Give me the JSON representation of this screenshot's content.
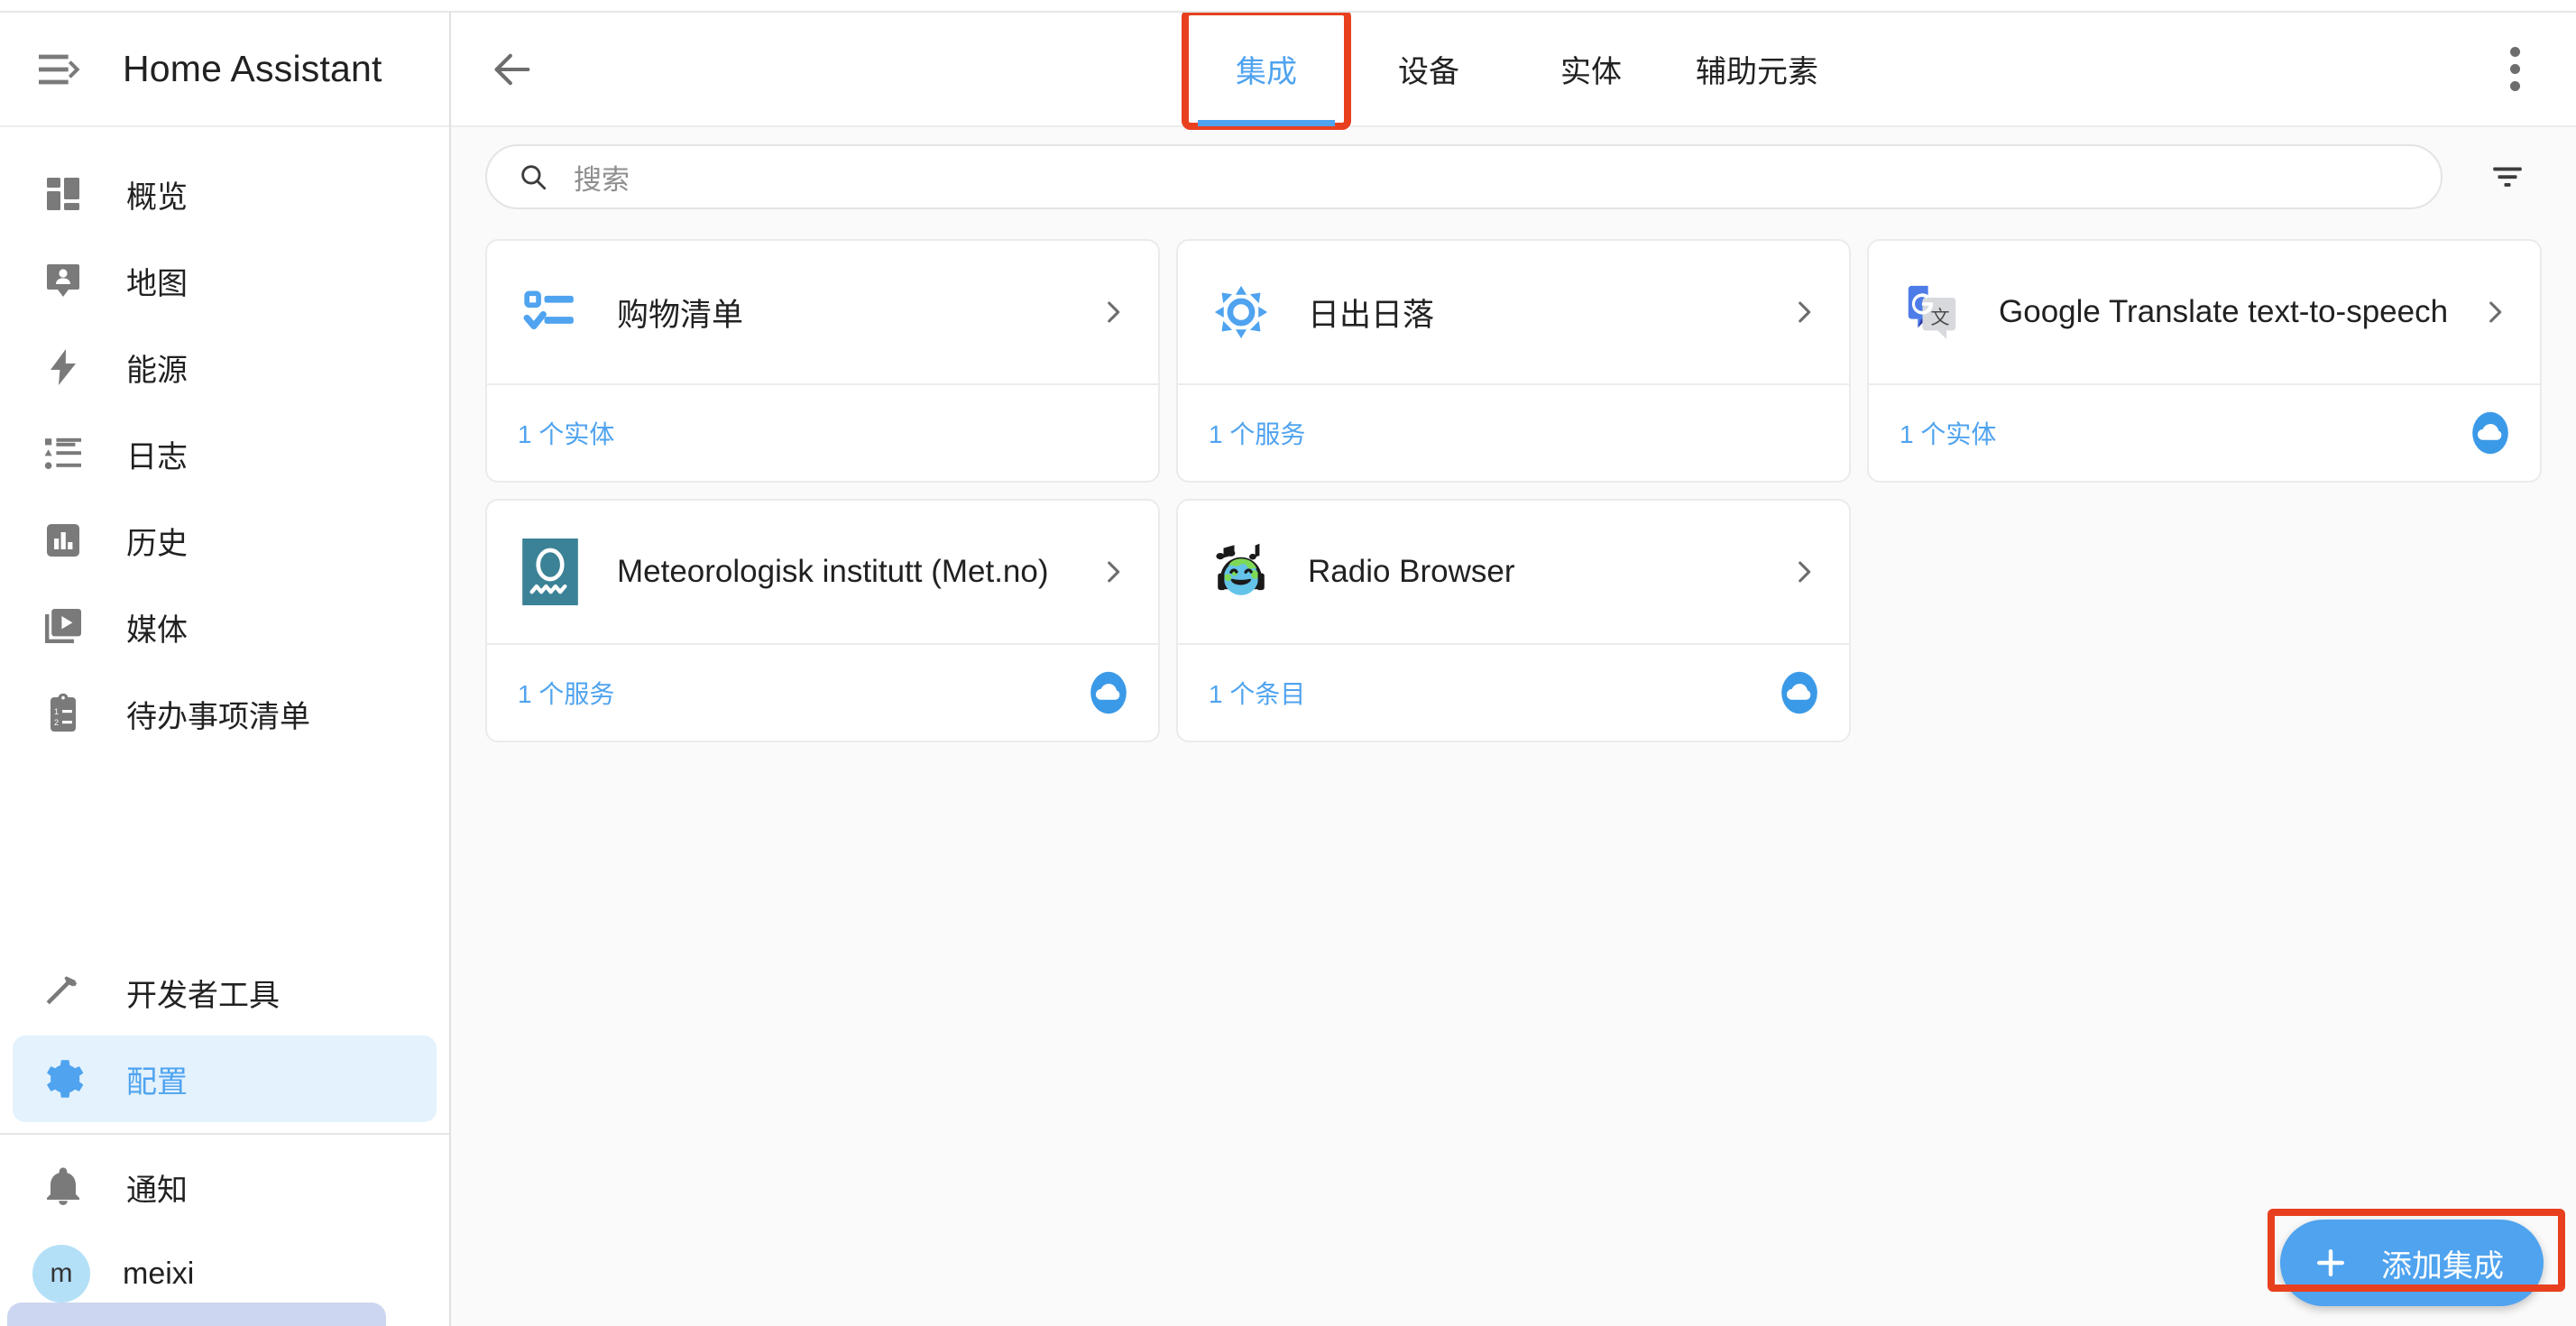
{
  "app": {
    "title": "Home Assistant",
    "accent_color": "#4fa3ef",
    "highlight_color": "#e8401f",
    "active_sidebar_bg": "#e3f2fd"
  },
  "sidebar": {
    "menu_icon": "hamburger-collapse-icon",
    "items": [
      {
        "label": "概览",
        "icon": "view-dashboard-icon",
        "active": false
      },
      {
        "label": "地图",
        "icon": "map-marker-account-icon",
        "active": false
      },
      {
        "label": "能源",
        "icon": "lightning-bolt-icon",
        "active": false
      },
      {
        "label": "日志",
        "icon": "format-list-bulleted-type-icon",
        "active": false
      },
      {
        "label": "历史",
        "icon": "chart-box-icon",
        "active": false
      },
      {
        "label": "媒体",
        "icon": "play-box-multiple-icon",
        "active": false
      },
      {
        "label": "待办事项清单",
        "icon": "clipboard-list-icon",
        "active": false
      }
    ],
    "tools": [
      {
        "label": "开发者工具",
        "icon": "hammer-wrench-icon",
        "active": false
      },
      {
        "label": "配置",
        "icon": "cog-icon",
        "active": true
      }
    ],
    "footer": [
      {
        "label": "通知",
        "icon": "bell-icon"
      }
    ],
    "user": {
      "label": "meixi",
      "avatar_initial": "m"
    }
  },
  "toolbar": {
    "back_icon": "arrow-left-icon",
    "overflow_icon": "dots-vertical-icon",
    "tabs": [
      {
        "label": "集成",
        "active": true,
        "highlighted": true
      },
      {
        "label": "设备",
        "active": false,
        "highlighted": false
      },
      {
        "label": "实体",
        "active": false,
        "highlighted": false
      },
      {
        "label": "辅助元素",
        "active": false,
        "highlighted": false
      }
    ]
  },
  "search": {
    "placeholder": "搜索",
    "value": "",
    "icon": "search-icon",
    "filter_icon": "filter-variant-icon"
  },
  "integrations": [
    {
      "name": "购物清单",
      "icon": "shopping-list-checklist-icon",
      "sub_label": "1 个实体",
      "cloud": false,
      "chevron": "chevron-right-icon"
    },
    {
      "name": "日出日落",
      "icon": "sun-brightness-icon",
      "sub_label": "1 个服务",
      "cloud": false,
      "chevron": "chevron-right-icon"
    },
    {
      "name": "Google Translate text-to-speech",
      "icon": "google-translate-logo-icon",
      "sub_label": "1 个实体",
      "cloud": true,
      "chevron": "chevron-right-icon"
    },
    {
      "name": "Meteorologisk institutt (Met.no)",
      "icon": "metno-logo-icon",
      "sub_label": "1 个服务",
      "cloud": true,
      "chevron": "chevron-right-icon"
    },
    {
      "name": "Radio Browser",
      "icon": "radio-browser-globe-headphones-icon",
      "sub_label": "1 个条目",
      "cloud": true,
      "chevron": "chevron-right-icon"
    }
  ],
  "fab": {
    "label": "添加集成",
    "icon": "plus-icon",
    "highlighted": true
  }
}
